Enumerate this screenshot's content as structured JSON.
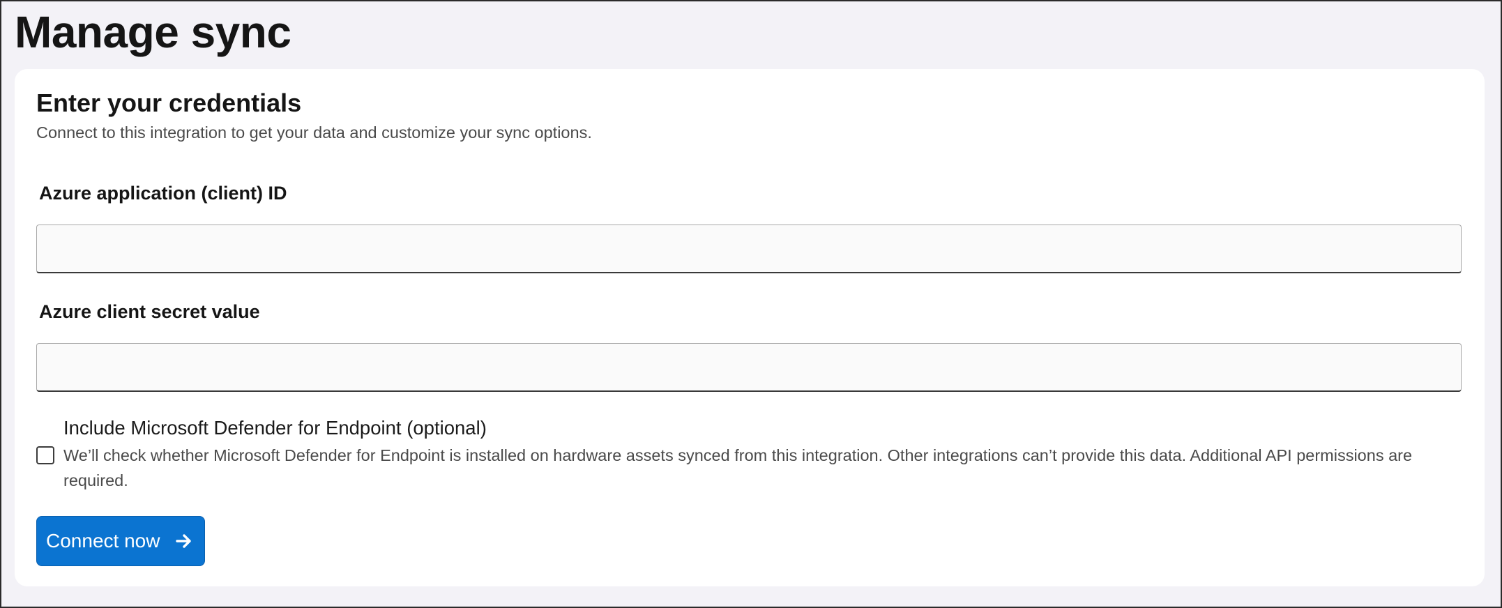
{
  "header": {
    "title": "Manage sync"
  },
  "card": {
    "title": "Enter your credentials",
    "subtitle": "Connect to this integration to get your data and customize your sync options."
  },
  "fields": {
    "client_id": {
      "label": "Azure application (client) ID",
      "value": "",
      "placeholder": ""
    },
    "client_secret": {
      "label": "Azure client secret value",
      "value": "",
      "placeholder": ""
    }
  },
  "defender_option": {
    "title": "Include Microsoft Defender for Endpoint (optional)",
    "description": "We’ll check whether Microsoft Defender for Endpoint is installed on hardware assets synced from this integration. Other integrations can’t provide this data. Additional API permissions are required.",
    "checked": false
  },
  "actions": {
    "connect_label": "Connect now",
    "connect_icon": "arrow-right-icon"
  },
  "colors": {
    "page_background": "#f3f2f7",
    "card_background": "#ffffff",
    "accent": "#0b74d1"
  }
}
